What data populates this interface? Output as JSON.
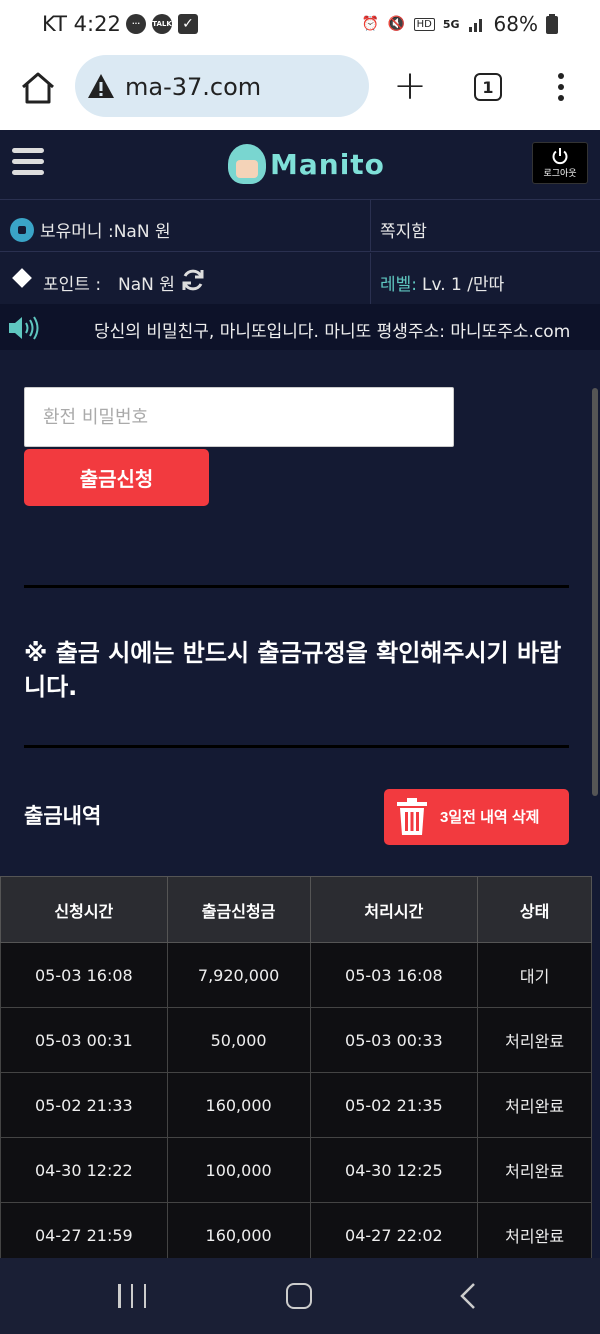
{
  "status_bar": {
    "carrier_time": "KT 4:22",
    "notif_talk": "TALK",
    "hd": "HD",
    "network": "5G",
    "battery": "68%"
  },
  "browser": {
    "url": "ma-37.com",
    "tab_count": "1"
  },
  "site": {
    "logo_text": "Manito",
    "logout_label": "로그아웃"
  },
  "info": {
    "money_label": "보유머니 :NaN 원",
    "memo_label": "쪽지함",
    "point_label": "포인트 :",
    "point_value": "NaN 원",
    "level_label": "레벨:",
    "level_value": "Lv. 1 /만따"
  },
  "marquee": {
    "message": "당신의 비밀친구, 마니또입니다. 마니또 평생주소: 마니또주소.com"
  },
  "form": {
    "password_placeholder": "환전 비밀번호",
    "submit_label": "출금신청"
  },
  "notice": {
    "text": "※ 출금 시에는 반드시 출금규정을 확인해주시기 바랍니다."
  },
  "history": {
    "title": "출금내역",
    "delete_label": "3일전 내역 삭제",
    "columns": [
      "신청시간",
      "출금신청금",
      "처리시간",
      "상태"
    ],
    "rows": [
      [
        "05-03 16:08",
        "7,920,000",
        "05-03 16:08",
        "대기"
      ],
      [
        "05-03 00:31",
        "50,000",
        "05-03 00:33",
        "처리완료"
      ],
      [
        "05-02 21:33",
        "160,000",
        "05-02 21:35",
        "처리완료"
      ],
      [
        "04-30 12:22",
        "100,000",
        "04-30 12:25",
        "처리완료"
      ],
      [
        "04-27 21:59",
        "160,000",
        "04-27 22:02",
        "처리완료"
      ]
    ]
  },
  "colors": {
    "accent_red": "#f23a3f",
    "background": "#141a33",
    "level_label": "#5fc7c0"
  }
}
